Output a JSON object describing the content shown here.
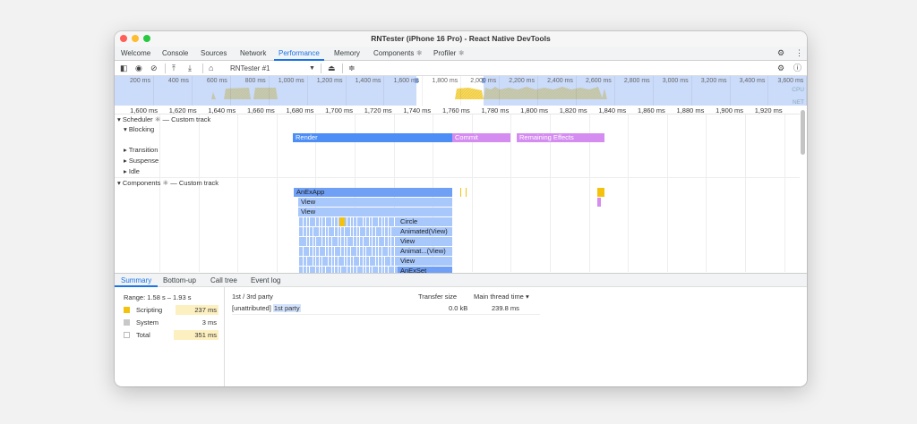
{
  "window": {
    "title": "RNTester (iPhone 16 Pro) - React Native DevTools"
  },
  "tabs": [
    {
      "label": "Welcome"
    },
    {
      "label": "Console"
    },
    {
      "label": "Sources"
    },
    {
      "label": "Network"
    },
    {
      "label": "Performance",
      "active": true
    },
    {
      "label": "Memory"
    },
    {
      "label": "Components ⚛"
    },
    {
      "label": "Profiler ⚛"
    }
  ],
  "toolbar": {
    "target_select": "RNTester #1",
    "icons": [
      "sidebar-toggle-icon",
      "record-icon",
      "clear-icon",
      "upload-icon",
      "download-icon",
      "home-icon",
      "dropdown-caret-icon",
      "memory-broom-icon",
      "collapse-tracks-icon",
      "settings-icon",
      "help-icon"
    ]
  },
  "overview": {
    "ticks": [
      "200 ms",
      "400 ms",
      "600 ms",
      "800 ms",
      "1,000 ms",
      "1,200 ms",
      "1,400 ms",
      "1,600 ms",
      "1,800 ms",
      "2,000 ms",
      "2,200 ms",
      "2,400 ms",
      "2,600 ms",
      "2,800 ms",
      "3,000 ms",
      "3,200 ms",
      "3,400 ms",
      "3,600 ms"
    ],
    "cpu_label": "CPU",
    "net_label": "NET",
    "selection": "1.58 s – 1.93 s"
  },
  "ruler": {
    "ticks": [
      "1,600 ms",
      "1,620 ms",
      "1,640 ms",
      "1,660 ms",
      "1,680 ms",
      "1,700 ms",
      "1,720 ms",
      "1,740 ms",
      "1,760 ms",
      "1,780 ms",
      "1,800 ms",
      "1,820 ms",
      "1,840 ms",
      "1,860 ms",
      "1,880 ms",
      "1,900 ms",
      "1,920 ms"
    ]
  },
  "scheduler": {
    "title": "Scheduler ⚛ — Custom track",
    "lanes": [
      "Blocking",
      "Transition",
      "Suspense",
      "Idle"
    ],
    "bars": [
      {
        "label": "Render",
        "color": "#4c8df6"
      },
      {
        "label": "Commit",
        "color": "#d48cf0"
      },
      {
        "label": "Remaining Effects",
        "color": "#d48cf0"
      }
    ]
  },
  "components": {
    "title": "Components ⚛ — Custom track",
    "rows": [
      "AnExApp",
      "View",
      "View",
      "Circle",
      "Animated(View)",
      "View",
      "Animat...(View)",
      "View",
      "AnExSet"
    ]
  },
  "bottom_tabs": [
    {
      "label": "Summary",
      "active": true
    },
    {
      "label": "Bottom-up"
    },
    {
      "label": "Call tree"
    },
    {
      "label": "Event log"
    }
  ],
  "summary": {
    "range": "Range: 1.58 s – 1.93 s",
    "items": [
      {
        "label": "Scripting",
        "value": "237 ms",
        "color": "#f4c20d"
      },
      {
        "label": "System",
        "value": "3 ms",
        "color": "#c8c8c8"
      },
      {
        "label": "Total",
        "value": "351 ms",
        "color": "#ffffff"
      }
    ]
  },
  "party_table": {
    "headers": [
      "1st / 3rd party",
      "Transfer size",
      "Main thread time ▾"
    ],
    "rows": [
      {
        "name": "[unattributed]",
        "badge": "1st party",
        "transfer": "0.0 kB",
        "time": "239.8 ms"
      }
    ]
  }
}
